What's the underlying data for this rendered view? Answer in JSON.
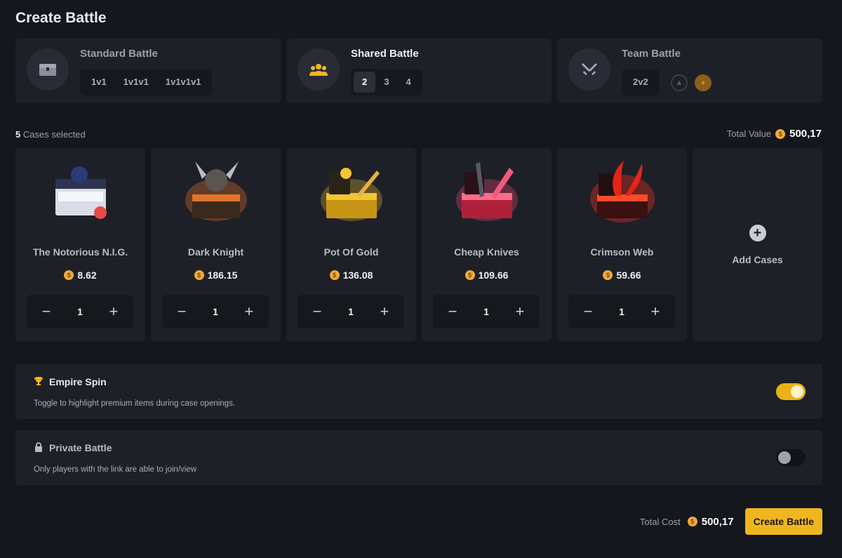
{
  "page": {
    "title": "Create Battle"
  },
  "modes": [
    {
      "title": "Standard Battle",
      "icon": "chest-icon",
      "options": [
        "1v1",
        "1v1v1",
        "1v1v1v1"
      ],
      "selected": null
    },
    {
      "title": "Shared Battle",
      "icon": "group-icon",
      "options": [
        "2",
        "3",
        "4"
      ],
      "selected": "2"
    },
    {
      "title": "Team Battle",
      "icon": "crossed-swords-icon",
      "options": [
        "2v2"
      ],
      "selected": null,
      "team_icons": [
        "team-a-icon",
        "team-b-icon"
      ]
    }
  ],
  "selection": {
    "count": "5",
    "count_label": "Cases selected",
    "total_label": "Total Value",
    "total_value": "500,17"
  },
  "cases": [
    {
      "name": "The Notorious N.I.G.",
      "price": "8.62",
      "qty": "1",
      "accent": "#4a7ce0"
    },
    {
      "name": "Dark Knight",
      "price": "186.15",
      "qty": "1",
      "accent": "#e0742a"
    },
    {
      "name": "Pot Of Gold",
      "price": "136.08",
      "qty": "1",
      "accent": "#f2c531"
    },
    {
      "name": "Cheap Knives",
      "price": "109.66",
      "qty": "1",
      "accent": "#ff4d7a"
    },
    {
      "name": "Crimson Web",
      "price": "59.66",
      "qty": "1",
      "accent": "#ff3020"
    }
  ],
  "add_cases": {
    "label": "Add Cases"
  },
  "options": {
    "empire_spin": {
      "title": "Empire Spin",
      "desc": "Toggle to highlight premium items during case openings.",
      "enabled": true
    },
    "private_battle": {
      "title": "Private Battle",
      "desc": "Only players with the link are able to join/view",
      "enabled": false
    }
  },
  "footer": {
    "total_label": "Total Cost",
    "total_value": "500,17",
    "create_label": "Create Battle"
  },
  "colors": {
    "accent": "#f0b620",
    "coin": "#f0a93b",
    "panel": "#1e2028",
    "background": "#15171e"
  }
}
